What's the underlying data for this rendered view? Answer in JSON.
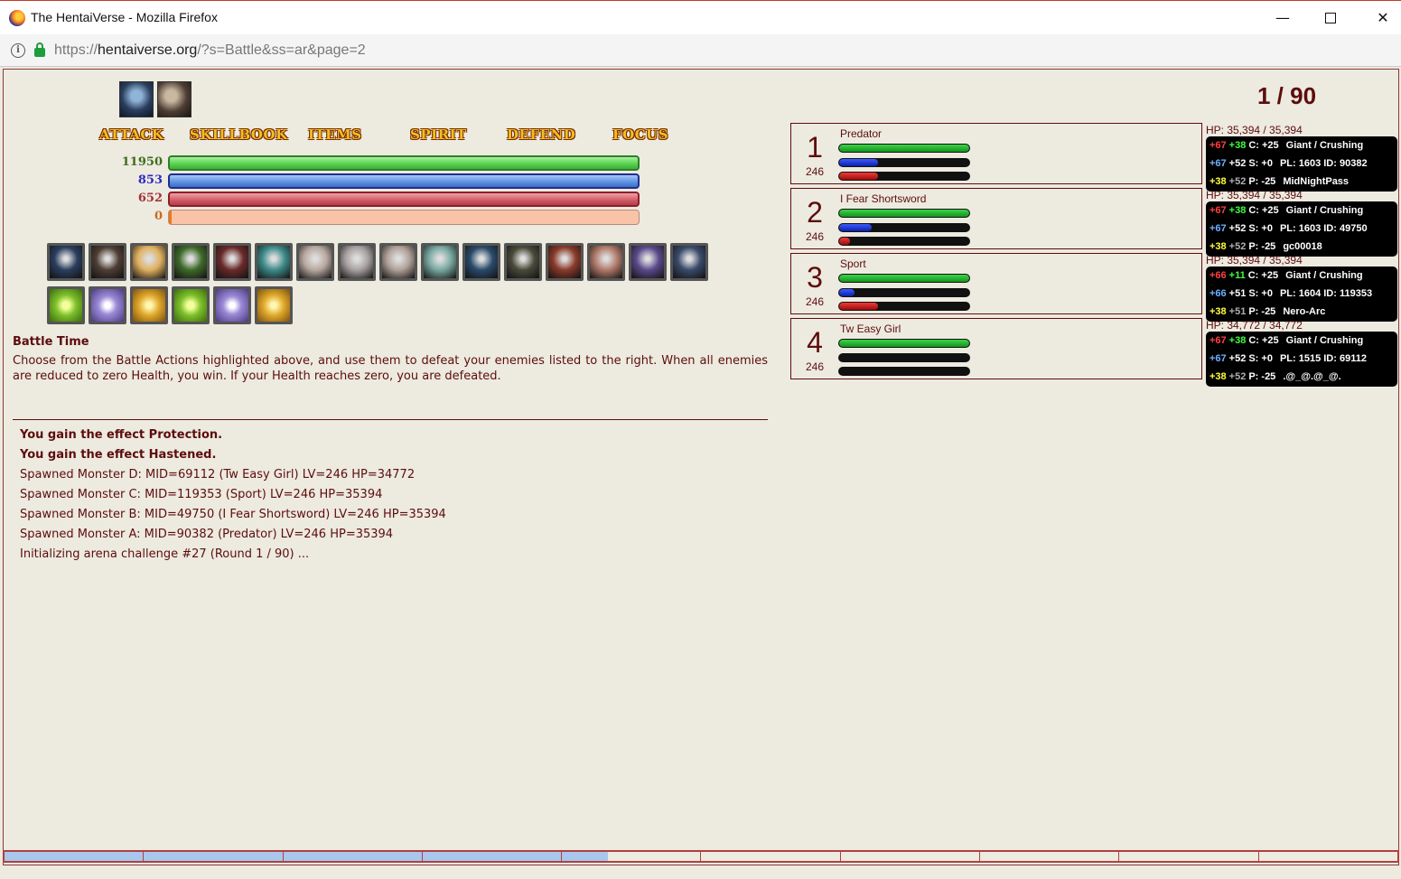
{
  "window": {
    "title": "The HentaiVerse - Mozilla Firefox",
    "min": "—",
    "close": "✕"
  },
  "urlbar": {
    "scheme": "https://",
    "host": "hentaiverse.org",
    "path": "/?s=Battle&ss=ar&page=2"
  },
  "menu": [
    "ATTACK",
    "SKILLBOOK",
    "ITEMS",
    "SPIRIT",
    "DEFEND",
    "FOCUS"
  ],
  "player": {
    "hp": "11950",
    "mp": "853",
    "sp": "652",
    "overcharge": "0",
    "hp_fraction": 1.0,
    "mp_fraction": 1.0,
    "sp_fraction": 1.0,
    "overcharge_fraction": 0.0
  },
  "round": "1 / 90",
  "battle": {
    "title": "Battle Time",
    "description": "Choose from the Battle Actions highlighted above, and use them to defeat your enemies listed to the right. When all enemies are reduced to zero Health, you win. If your Health reaches zero, you are defeated."
  },
  "log": [
    {
      "text": "You gain the effect Protection.",
      "bold": true
    },
    {
      "text": "You gain the effect Hastened.",
      "bold": true
    },
    {
      "text": "Spawned Monster D: MID=69112 (Tw Easy Girl) LV=246 HP=34772",
      "bold": false
    },
    {
      "text": "Spawned Monster C: MID=119353 (Sport) LV=246 HP=35394",
      "bold": false
    },
    {
      "text": "Spawned Monster B: MID=49750 (I Fear Shortsword) LV=246 HP=35394",
      "bold": false
    },
    {
      "text": "Spawned Monster A: MID=90382 (Predator) LV=246 HP=35394",
      "bold": false
    },
    {
      "text": "Initializing arena challenge #27 (Round 1 / 90) ...",
      "bold": false
    }
  ],
  "monsters": [
    {
      "num": "1",
      "level": "246",
      "name": "Predator",
      "hp_text": "HP: 35,394 / 35,394",
      "hp": 1.0,
      "mp": 0.3,
      "sp": 0.3,
      "tt": [
        [
          "+67",
          "+38",
          "C: +25",
          "Giant / Crushing"
        ],
        [
          "+67",
          "+52",
          "S: +0",
          "PL: 1603 ID: 90382"
        ],
        [
          "+38",
          "+52",
          "P: -25",
          "MidNightPass"
        ]
      ]
    },
    {
      "num": "2",
      "level": "246",
      "name": "I Fear Shortsword",
      "hp_text": "HP: 35,394 / 35,394",
      "hp": 1.0,
      "mp": 0.25,
      "sp": 0.08,
      "tt": [
        [
          "+67",
          "+38",
          "C: +25",
          "Giant / Crushing"
        ],
        [
          "+67",
          "+52",
          "S: +0",
          "PL: 1603 ID: 49750"
        ],
        [
          "+38",
          "+52",
          "P: -25",
          "gc00018"
        ]
      ]
    },
    {
      "num": "3",
      "level": "246",
      "name": "Sport",
      "hp_text": "HP: 35,394 / 35,394",
      "hp": 1.0,
      "mp": 0.12,
      "sp": 0.3,
      "tt": [
        [
          "+66",
          "+11",
          "C: +25",
          "Giant / Crushing"
        ],
        [
          "+66",
          "+51",
          "S: +0",
          "PL: 1604 ID: 119353"
        ],
        [
          "+38",
          "+51",
          "P: -25",
          "Nero-Arc"
        ]
      ]
    },
    {
      "num": "4",
      "level": "246",
      "name": "Tw Easy Girl",
      "hp_text": "HP: 34,772 / 34,772",
      "hp": 1.0,
      "mp": 0.0,
      "sp": 0.0,
      "tt": [
        [
          "+67",
          "+38",
          "C: +25",
          "Giant / Crushing"
        ],
        [
          "+67",
          "+52",
          "S: +0",
          "PL: 1515 ID: 69112"
        ],
        [
          "+38",
          "+52",
          "P: -25",
          ".@_@.@_@."
        ]
      ]
    }
  ],
  "skill_icons": [
    "spirit-icon",
    "warrior-icon",
    "burst-icon",
    "monk-icon",
    "berserker-icon",
    "spirit-beast-icon",
    "slash-icon",
    "cleave-icon",
    "strike-icon",
    "dash-icon",
    "shadow-icon",
    "bearded-icon",
    "flame-warrior-icon",
    "skull-icon",
    "sorcerer-icon",
    "phantom-icon"
  ],
  "item_icons": [
    "health-potion-icon",
    "mana-potion-icon",
    "spirit-potion-icon",
    "health-potion-icon",
    "mana-potion-icon",
    "spirit-potion-icon"
  ],
  "progress": [
    1,
    1,
    1,
    1,
    0.33,
    0,
    0,
    0,
    0,
    0
  ],
  "colors": {
    "text": "#5c0d0d",
    "background": "#EDEAE0",
    "menu_gold": "#f0c020"
  }
}
